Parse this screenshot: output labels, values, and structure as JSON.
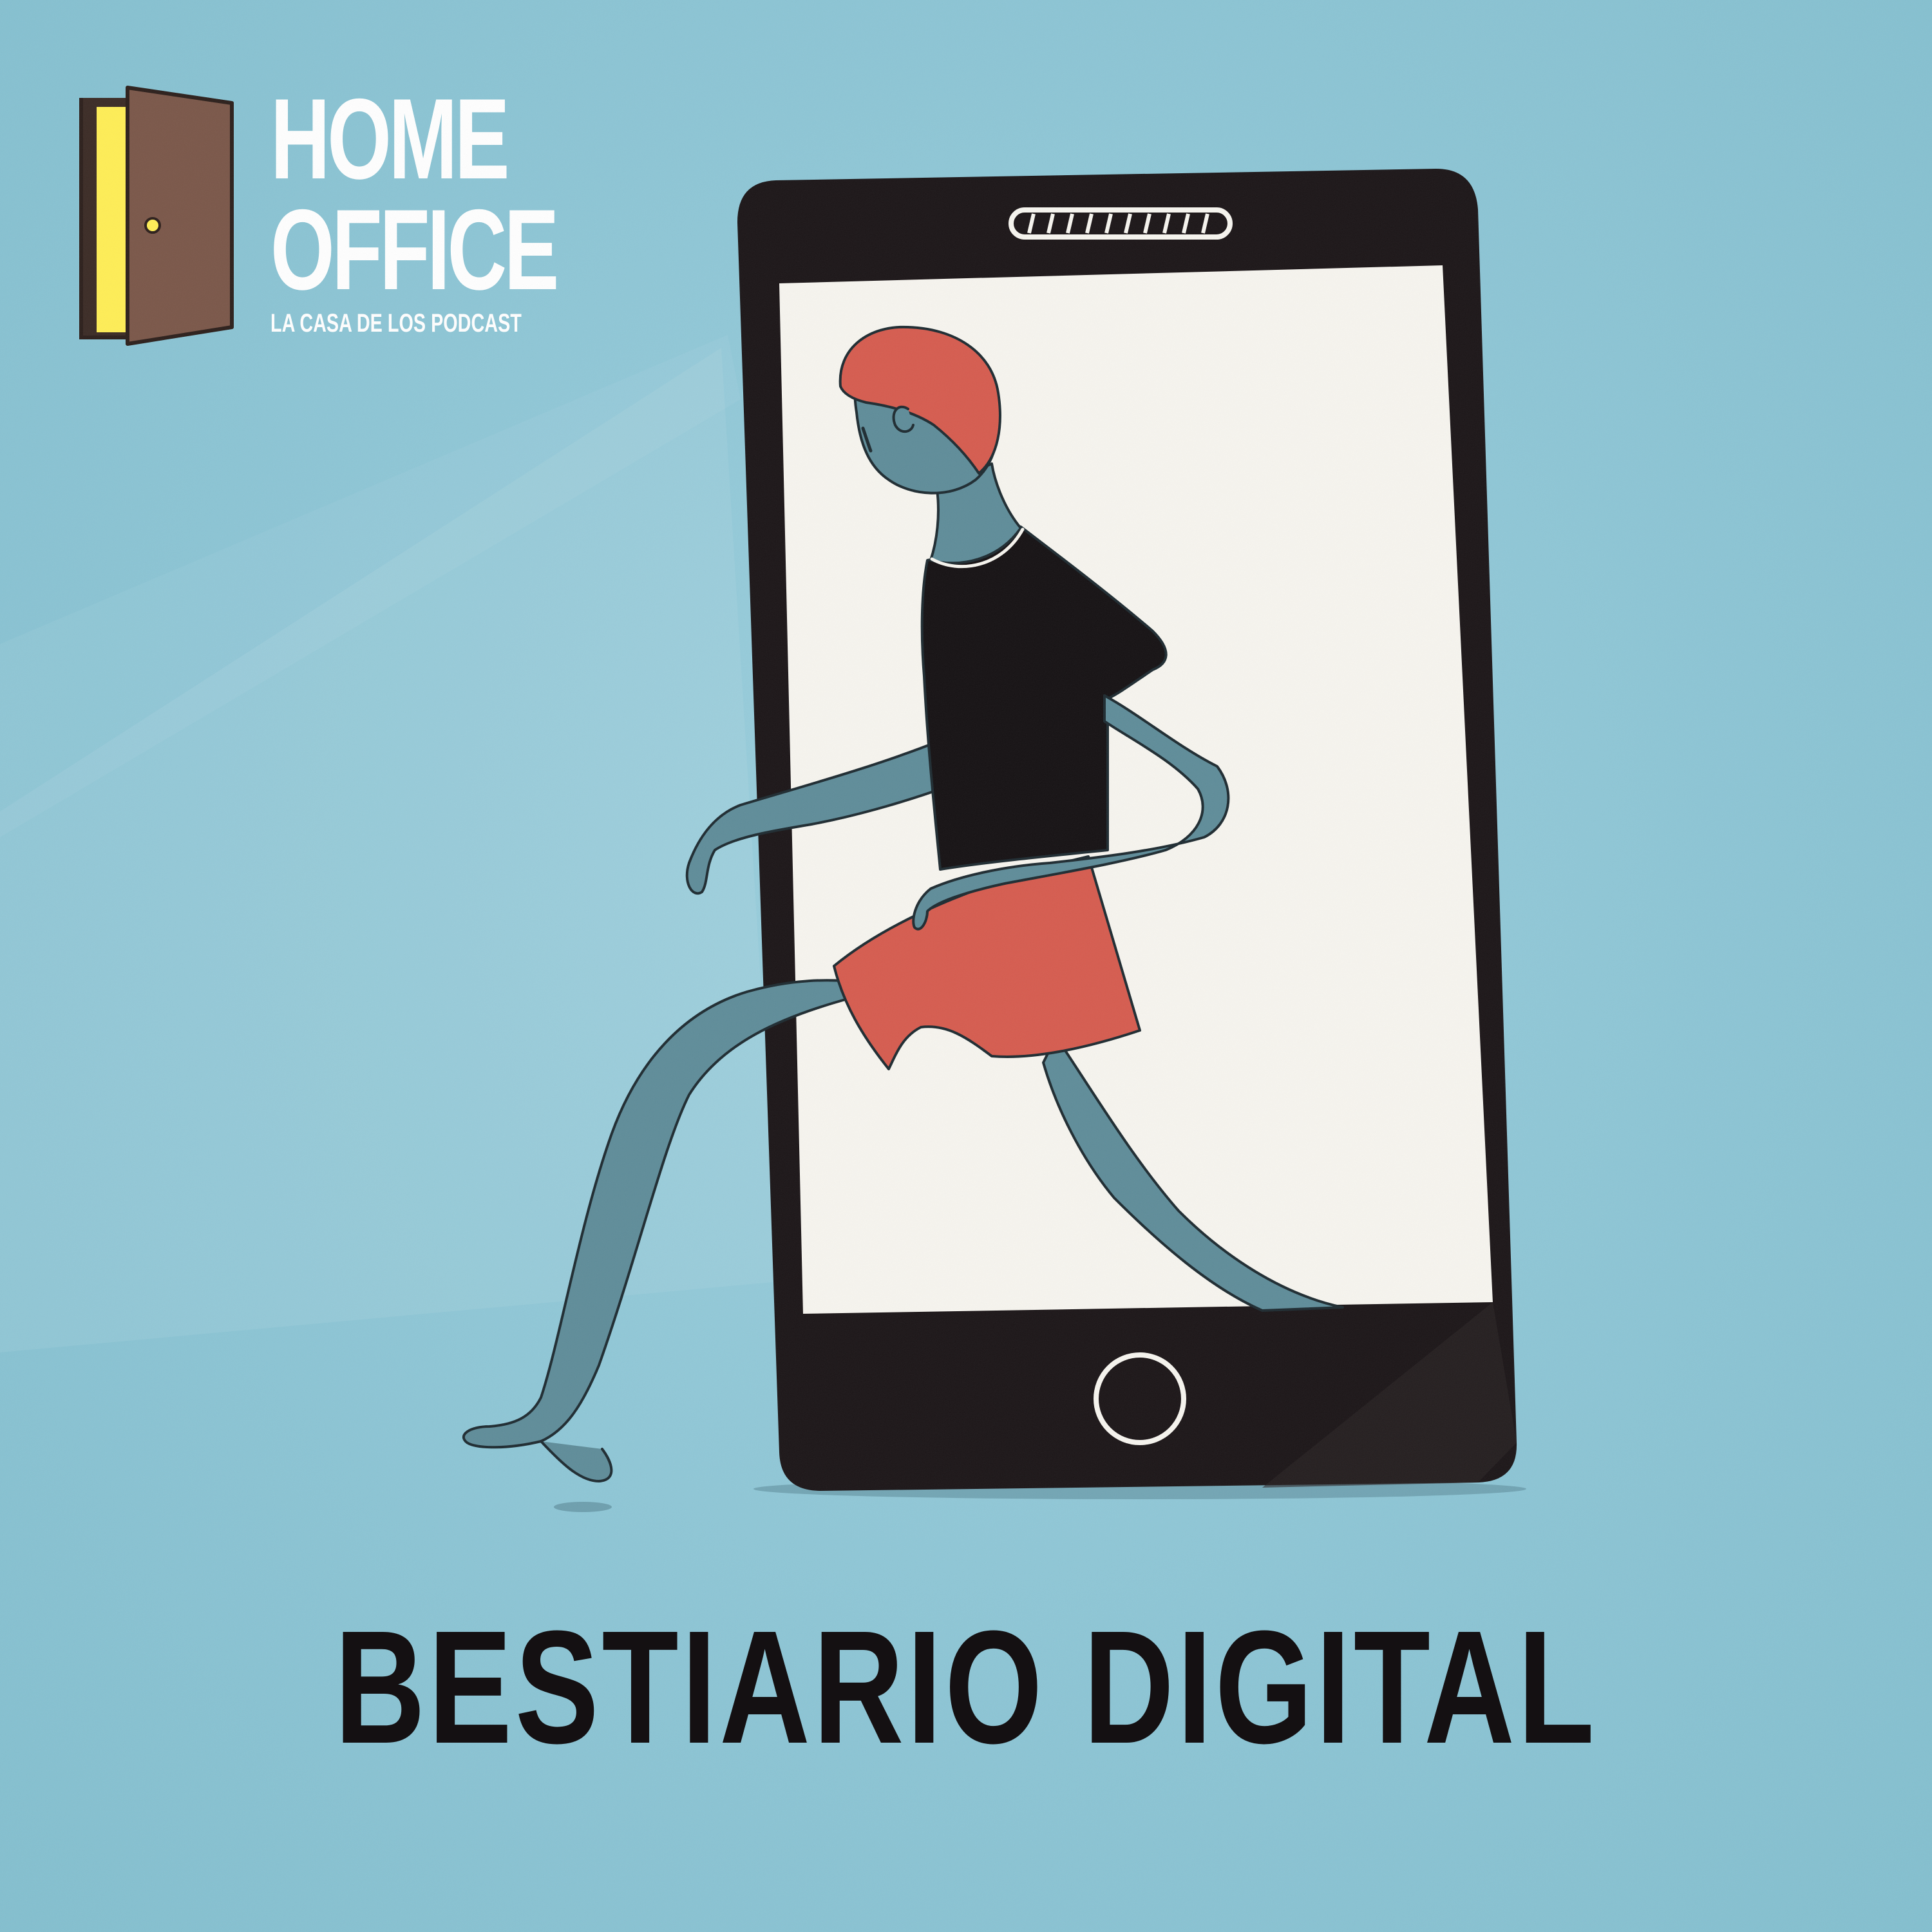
{
  "logo": {
    "line1": "HOME",
    "line2": "OFFICE",
    "tagline": "LA CASA DE LOS PODCAST"
  },
  "title": "BESTIARIO DIGITAL",
  "colors": {
    "background": "#8ec6d6",
    "phone_body": "#1a1416",
    "screen": "#f7f5ef",
    "figure_skin": "#5e8c99",
    "hair": "#d65b4e",
    "shorts": "#d65b4e",
    "shirt": "#141012",
    "door": "#7a5648",
    "door_light": "#ffee55",
    "logo_text": "#ffffff"
  },
  "icons": {
    "logo": "door-icon",
    "phone": "smartphone-icon",
    "home_button": "home-button-icon",
    "speaker": "speaker-grille-icon"
  }
}
